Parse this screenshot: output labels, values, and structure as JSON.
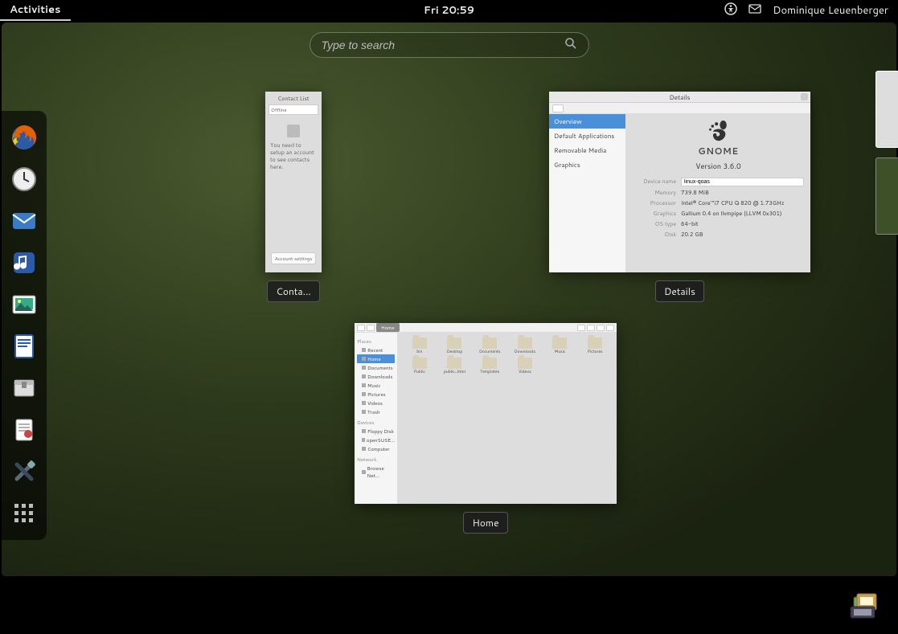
{
  "topbar": {
    "activities_label": "Activities",
    "clock": "Fri 20:59",
    "username": "Dominique Leuenberger"
  },
  "search": {
    "placeholder": "Type to search"
  },
  "dash": {
    "apps": [
      {
        "name": "firefox",
        "label": "Firefox"
      },
      {
        "name": "clock",
        "label": "Clock"
      },
      {
        "name": "evolution",
        "label": "Evolution"
      },
      {
        "name": "banshee",
        "label": "Banshee"
      },
      {
        "name": "shotwell",
        "label": "Shotwell"
      },
      {
        "name": "libreoffice-writer",
        "label": "LibreOffice Writer"
      },
      {
        "name": "file-roller",
        "label": "Archive Manager"
      },
      {
        "name": "document-viewer",
        "label": "Document Viewer"
      },
      {
        "name": "settings",
        "label": "Settings"
      },
      {
        "name": "show-apps",
        "label": "Show Applications"
      }
    ]
  },
  "windows": {
    "contacts": {
      "label": "Conta...",
      "title": "Contact List",
      "status": "Offline",
      "message": "You need to setup an account to see contacts here.",
      "button": "Account settings"
    },
    "details": {
      "label": "Details",
      "title": "Details",
      "sidebar": [
        "Overview",
        "Default Applications",
        "Removable Media",
        "Graphics"
      ],
      "sidebar_selected": 0,
      "logo_text": "GNOME",
      "version": "Version 3.6.0",
      "rows": [
        {
          "k": "Device name",
          "v": "linux-qoas",
          "editable": true
        },
        {
          "k": "Memory",
          "v": "739.8 MiB"
        },
        {
          "k": "Processor",
          "v": "Intel® Core™i7 CPU Q 820 @ 1.73GHz"
        },
        {
          "k": "Graphics",
          "v": "Gallium 0.4 on llvmpipe (LLVM 0x301)"
        },
        {
          "k": "OS type",
          "v": "64-bit"
        },
        {
          "k": "Disk",
          "v": "20.2 GB"
        }
      ]
    },
    "files": {
      "label": "Home",
      "breadcrumb": "Home",
      "sidebar": {
        "places_hdr": "Places",
        "places": [
          "Recent",
          "Home",
          "Documents",
          "Downloads",
          "Music",
          "Pictures",
          "Videos",
          "Trash"
        ],
        "places_selected": 1,
        "devices_hdr": "Devices",
        "devices": [
          "Floppy Disk",
          "openSUSE…",
          "Computer"
        ],
        "network_hdr": "Network",
        "network": [
          "Browse Net..."
        ]
      },
      "folders": [
        "bin",
        "Desktop",
        "Documents",
        "Downloads",
        "Music",
        "Pictures",
        "Public",
        "public_html",
        "Templates",
        "Videos"
      ]
    }
  },
  "workspaces": {
    "count": 2,
    "active": 0
  },
  "tray": {
    "removable_label": "Removable Devices"
  }
}
